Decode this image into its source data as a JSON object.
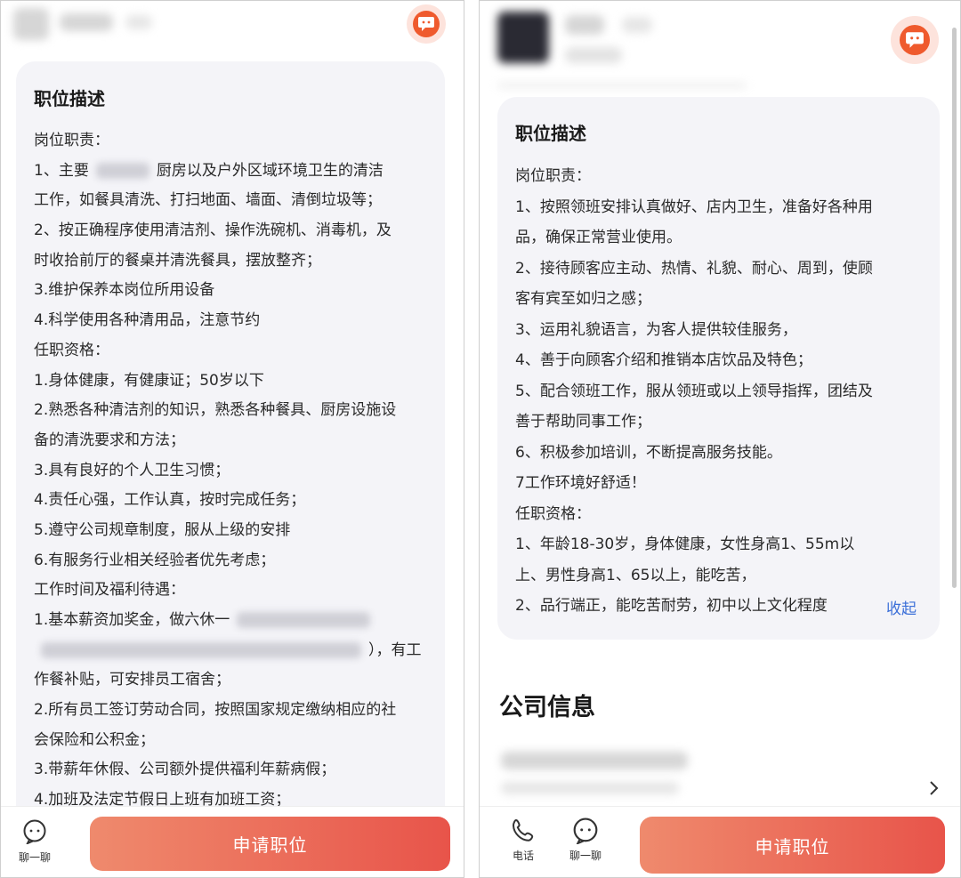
{
  "left": {
    "card_title": "职位描述",
    "lines": [
      {
        "text": "岗位职责："
      },
      {
        "pre": "1、主要",
        "post": "厨房以及户外区域环境卫生的清洁",
        "blur_w": 60
      },
      {
        "text": "工作，如餐具清洗、打扫地面、墙面、清倒垃圾等；"
      },
      {
        "text": "2、按正确程序使用清洁剂、操作洗碗机、消毒机，及"
      },
      {
        "text": "时收拾前厅的餐桌并清洗餐具，摆放整齐；"
      },
      {
        "text": "3.维护保养本岗位所用设备"
      },
      {
        "text": "4.科学使用各种清用品，注意节约"
      },
      {
        "text": "任职资格："
      },
      {
        "text": "1.身体健康，有健康证；50岁以下"
      },
      {
        "text": "2.熟悉各种清洁剂的知识，熟悉各种餐具、厨房设施设"
      },
      {
        "text": "备的清洗要求和方法；"
      },
      {
        "text": "3.具有良好的个人卫生习惯；"
      },
      {
        "text": "4.责任心强，工作认真，按时完成任务；"
      },
      {
        "text": "5.遵守公司规章制度，服从上级的安排"
      },
      {
        "text": "6.有服务行业相关经验者优先考虑；"
      },
      {
        "text": "工作时间及福利待遇："
      },
      {
        "pre": "1.基本薪资加奖金，做六休一",
        "post": "",
        "blur_w": 150
      },
      {
        "pre": "",
        "post": "），有工",
        "blur_w": 360
      },
      {
        "text": "作餐补贴，可安排员工宿舍；"
      },
      {
        "text": "2.所有员工签订劳动合同，按照国家规定缴纳相应的社"
      },
      {
        "text": "会保险和公积金；"
      },
      {
        "text": "3.带薪年休假、公司额外提供福利年薪病假；"
      },
      {
        "text": "4.加班及法定节假日上班有加班工资；"
      }
    ],
    "chat_label": "聊一聊",
    "apply_label": "申请职位"
  },
  "right": {
    "card_title": "职位描述",
    "lines": [
      "岗位职责：",
      "1、按照领班安排认真做好、店内卫生，准备好各种用",
      "品，确保正常营业使用。",
      "2、接待顾客应主动、热情、礼貌、耐心、周到，使顾",
      "客有宾至如归之感；",
      "3、运用礼貌语言，为客人提供较佳服务，",
      "4、善于向顾客介绍和推销本店饮品及特色；",
      "5、配合领班工作，服从领班或以上领导指挥，团结及",
      "善于帮助同事工作；",
      "6、积极参加培训，不断提高服务技能。",
      "7工作环境好舒适！",
      "任职资格：",
      "1、年龄18-30岁，身体健康，女性身高1、55m以",
      "上、男性身高1、65以上，能吃苦，",
      "2、品行端正，能吃苦耐劳，初中以上文化程度"
    ],
    "collapse_label": "收起",
    "company_title": "公司信息",
    "phone_label": "电话",
    "chat_label": "聊一聊",
    "apply_label": "申请职位"
  },
  "colors": {
    "accent": "#ef5a2d",
    "button_start": "#ef8a6d",
    "button_end": "#e8544a",
    "link": "#3b6fd8",
    "card_bg": "#f4f4f8"
  },
  "icons": [
    "chat-bubble-icon",
    "phone-icon",
    "chevron-right-icon"
  ]
}
